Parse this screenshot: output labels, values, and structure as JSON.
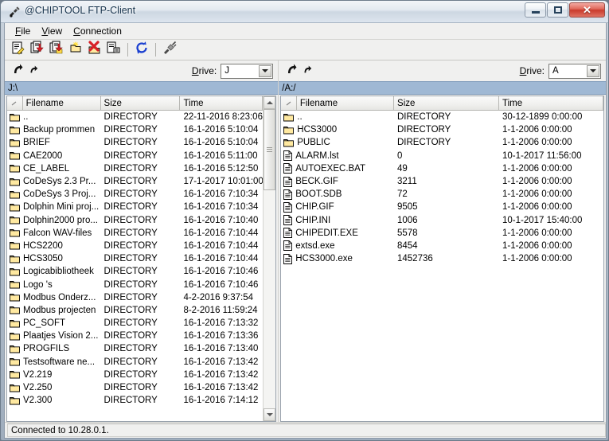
{
  "window": {
    "title": "@CHIPTOOL FTP-Client",
    "title_icon": "plug-icon",
    "minimize_label": "–",
    "maximize_label": "□",
    "close_label": "✕"
  },
  "menubar": {
    "items": [
      {
        "label": "File",
        "accel": "F"
      },
      {
        "label": "View",
        "accel": "V"
      },
      {
        "label": "Connection",
        "accel": "C"
      }
    ]
  },
  "toolbar": {
    "buttons": [
      {
        "name": "rename-file-icon",
        "title": "Rename / edit"
      },
      {
        "name": "download-file-icon",
        "title": "Download"
      },
      {
        "name": "upload-file-icon",
        "title": "Upload"
      },
      {
        "name": "new-folder-icon",
        "title": "New folder"
      },
      {
        "name": "delete-file-icon",
        "title": "Delete"
      },
      {
        "name": "file-properties-icon",
        "title": "Properties"
      },
      {
        "name": "refresh-icon",
        "title": "Refresh"
      },
      {
        "name": "connect-icon",
        "title": "Connect"
      }
    ]
  },
  "left_pane": {
    "nav": {
      "back_icon": "nav-back-icon",
      "up_icon": "nav-up-icon",
      "drive_label": "Drive:",
      "drive_accel": "D",
      "drive_value": "J"
    },
    "path": "J:\\",
    "columns": [
      "",
      "Filename",
      "Size",
      "Time"
    ],
    "rows": [
      {
        "icon": "folder",
        "name": "..",
        "size": "DIRECTORY",
        "time": "22-11-2016 8:23:06"
      },
      {
        "icon": "folder",
        "name": "Backup prommen",
        "size": "DIRECTORY",
        "time": "16-1-2016 5:10:04"
      },
      {
        "icon": "folder",
        "name": "BRIEF",
        "size": "DIRECTORY",
        "time": "16-1-2016 5:10:04"
      },
      {
        "icon": "folder",
        "name": "CAE2000",
        "size": "DIRECTORY",
        "time": "16-1-2016 5:11:00"
      },
      {
        "icon": "folder",
        "name": "CE_LABEL",
        "size": "DIRECTORY",
        "time": "16-1-2016 5:12:50"
      },
      {
        "icon": "folder",
        "name": "CoDeSys 2.3 Pr...",
        "size": "DIRECTORY",
        "time": "17-1-2017 10:01:00"
      },
      {
        "icon": "folder",
        "name": "CoDeSys 3 Proj...",
        "size": "DIRECTORY",
        "time": "16-1-2016 7:10:34"
      },
      {
        "icon": "folder",
        "name": "Dolphin Mini proj...",
        "size": "DIRECTORY",
        "time": "16-1-2016 7:10:34"
      },
      {
        "icon": "folder",
        "name": "Dolphin2000 pro...",
        "size": "DIRECTORY",
        "time": "16-1-2016 7:10:40"
      },
      {
        "icon": "folder",
        "name": "Falcon WAV-files",
        "size": "DIRECTORY",
        "time": "16-1-2016 7:10:44"
      },
      {
        "icon": "folder",
        "name": "HCS2200",
        "size": "DIRECTORY",
        "time": "16-1-2016 7:10:44"
      },
      {
        "icon": "folder",
        "name": "HCS3050",
        "size": "DIRECTORY",
        "time": "16-1-2016 7:10:44"
      },
      {
        "icon": "folder",
        "name": "Logicabibliotheek",
        "size": "DIRECTORY",
        "time": "16-1-2016 7:10:46"
      },
      {
        "icon": "folder",
        "name": "Logo 's",
        "size": "DIRECTORY",
        "time": "16-1-2016 7:10:46"
      },
      {
        "icon": "folder",
        "name": "Modbus Onderz...",
        "size": "DIRECTORY",
        "time": "4-2-2016 9:37:54"
      },
      {
        "icon": "folder",
        "name": "Modbus projecten",
        "size": "DIRECTORY",
        "time": "8-2-2016 11:59:24"
      },
      {
        "icon": "folder",
        "name": "PC_SOFT",
        "size": "DIRECTORY",
        "time": "16-1-2016 7:13:32"
      },
      {
        "icon": "folder",
        "name": "Plaatjes Vision 2...",
        "size": "DIRECTORY",
        "time": "16-1-2016 7:13:36"
      },
      {
        "icon": "folder",
        "name": "PROGFILS",
        "size": "DIRECTORY",
        "time": "16-1-2016 7:13:40"
      },
      {
        "icon": "folder",
        "name": "Testsoftware ne...",
        "size": "DIRECTORY",
        "time": "16-1-2016 7:13:42"
      },
      {
        "icon": "folder",
        "name": "V2.219",
        "size": "DIRECTORY",
        "time": "16-1-2016 7:13:42"
      },
      {
        "icon": "folder",
        "name": "V2.250",
        "size": "DIRECTORY",
        "time": "16-1-2016 7:13:42"
      },
      {
        "icon": "folder",
        "name": "V2.300",
        "size": "DIRECTORY",
        "time": "16-1-2016 7:14:12"
      }
    ],
    "scrollbar": {
      "thumb_top_pct": 0,
      "thumb_height_pct": 27
    }
  },
  "right_pane": {
    "nav": {
      "back_icon": "nav-back-icon",
      "up_icon": "nav-up-icon",
      "drive_label": "Drive:",
      "drive_accel": "D",
      "drive_value": "A"
    },
    "path": "/A:/",
    "columns": [
      "",
      "Filename",
      "Size",
      "Time"
    ],
    "rows": [
      {
        "icon": "folder",
        "name": "..",
        "size": "DIRECTORY",
        "time": "30-12-1899 0:00:00"
      },
      {
        "icon": "folder",
        "name": "HCS3000",
        "size": "DIRECTORY",
        "time": "1-1-2006 0:00:00"
      },
      {
        "icon": "folder",
        "name": "PUBLIC",
        "size": "DIRECTORY",
        "time": "1-1-2006 0:00:00"
      },
      {
        "icon": "file",
        "name": "ALARM.lst",
        "size": "0",
        "time": "10-1-2017 11:56:00"
      },
      {
        "icon": "file",
        "name": "AUTOEXEC.BAT",
        "size": "49",
        "time": "1-1-2006 0:00:00"
      },
      {
        "icon": "file",
        "name": "BECK.GIF",
        "size": "3211",
        "time": "1-1-2006 0:00:00"
      },
      {
        "icon": "file",
        "name": "BOOT.SDB",
        "size": "72",
        "time": "1-1-2006 0:00:00"
      },
      {
        "icon": "file",
        "name": "CHIP.GIF",
        "size": "9505",
        "time": "1-1-2006 0:00:00"
      },
      {
        "icon": "file",
        "name": "CHIP.INI",
        "size": "1006",
        "time": "10-1-2017 15:40:00"
      },
      {
        "icon": "file",
        "name": "CHIPEDIT.EXE",
        "size": "5578",
        "time": "1-1-2006 0:00:00"
      },
      {
        "icon": "file",
        "name": "extsd.exe",
        "size": "8454",
        "time": "1-1-2006 0:00:00"
      },
      {
        "icon": "file",
        "name": "HCS3000.exe",
        "size": "1452736",
        "time": "1-1-2006 0:00:00"
      }
    ]
  },
  "statusbar": {
    "text": "Connected to 10.28.0.1."
  },
  "colors": {
    "path_bar": "#9fb8d4",
    "folder": "#ffe9a0",
    "accent_close": "#c93b2c"
  }
}
